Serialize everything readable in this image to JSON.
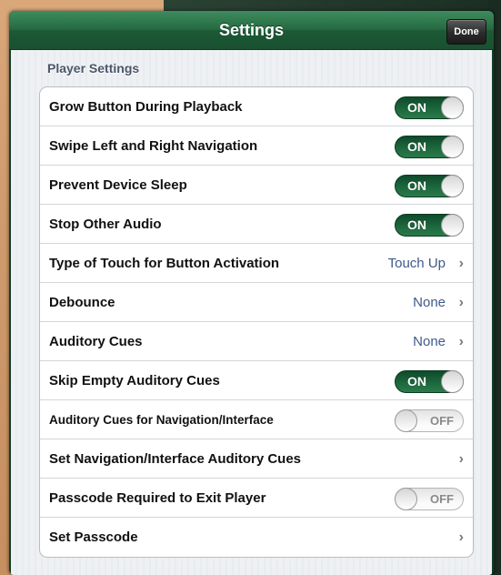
{
  "navbar": {
    "title": "Settings",
    "done_label": "Done"
  },
  "section": {
    "header": "Player Settings"
  },
  "rows": [
    {
      "label": "Grow Button During Playback",
      "toggle": "ON"
    },
    {
      "label": "Swipe Left and Right Navigation",
      "toggle": "ON"
    },
    {
      "label": "Prevent Device Sleep",
      "toggle": "ON"
    },
    {
      "label": "Stop Other Audio",
      "toggle": "ON"
    },
    {
      "label": "Type of Touch for Button Activation",
      "detail": "Touch Up",
      "chevron": "›"
    },
    {
      "label": "Debounce",
      "detail": "None",
      "chevron": "›"
    },
    {
      "label": "Auditory Cues",
      "detail": "None",
      "chevron": "›"
    },
    {
      "label": "Skip Empty Auditory Cues",
      "toggle": "ON"
    },
    {
      "label": "Auditory Cues for Navigation/Interface",
      "toggle": "OFF"
    },
    {
      "label": "Set Navigation/Interface Auditory Cues",
      "chevron": "›"
    },
    {
      "label": "Passcode Required to Exit Player",
      "toggle": "OFF"
    },
    {
      "label": "Set Passcode",
      "chevron": "›"
    }
  ],
  "colors": {
    "navbar": "#256a41",
    "toggle_on": "#1e6a3f",
    "detail_text": "#3d5a8a"
  }
}
